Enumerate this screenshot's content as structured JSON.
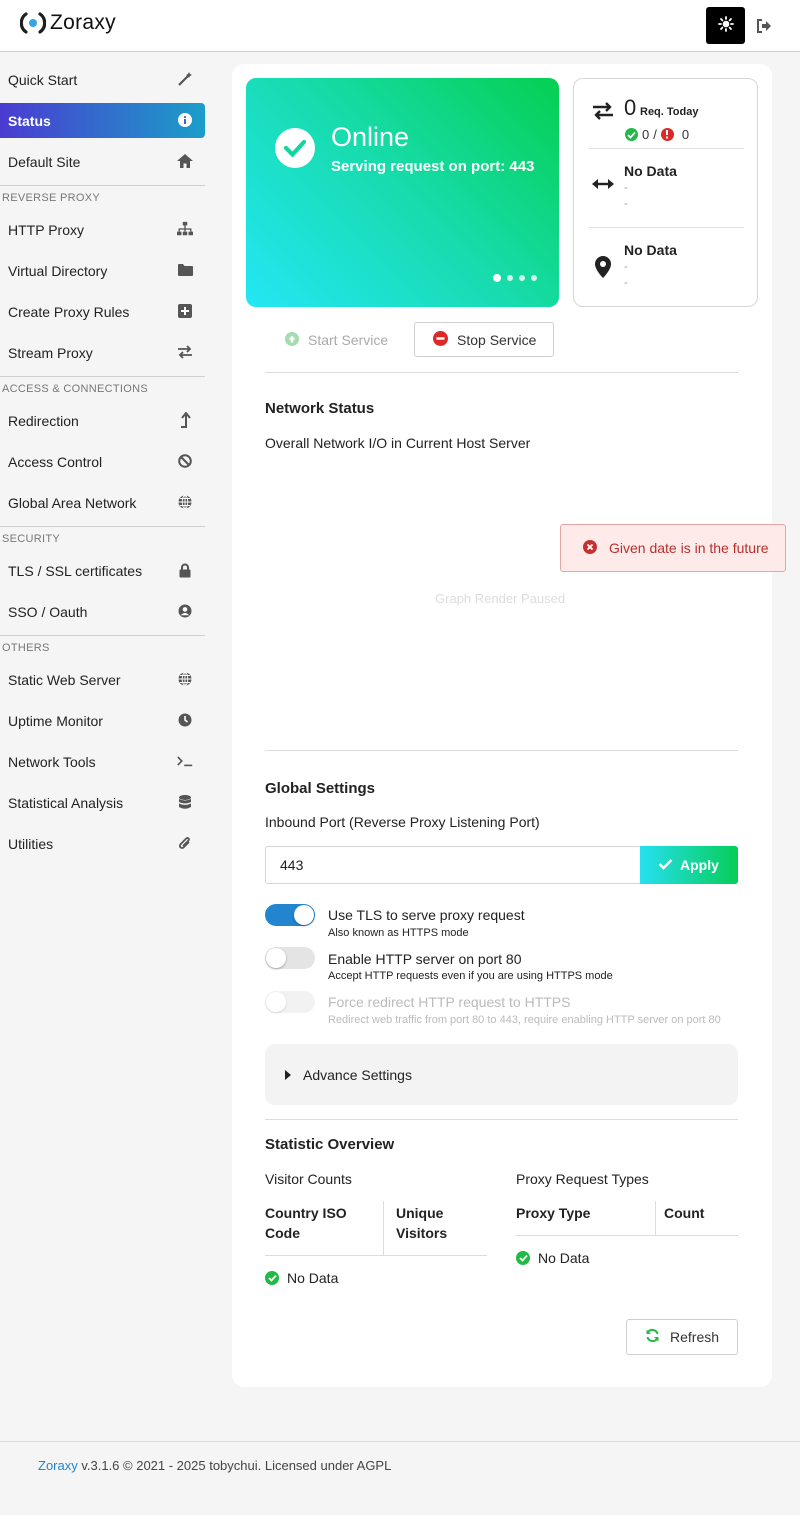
{
  "app": {
    "name": "Zoraxy"
  },
  "sidebar": {
    "items": [
      {
        "label": "Quick Start",
        "icon": "magic-wand-icon"
      },
      {
        "label": "Status",
        "icon": "info-circle-icon",
        "active": true
      },
      {
        "label": "Default Site",
        "icon": "home-icon"
      }
    ],
    "sections": [
      {
        "title": "REVERSE PROXY",
        "items": [
          {
            "label": "HTTP Proxy",
            "icon": "sitemap-icon"
          },
          {
            "label": "Virtual Directory",
            "icon": "folder-icon"
          },
          {
            "label": "Create Proxy Rules",
            "icon": "plus-square-icon"
          },
          {
            "label": "Stream Proxy",
            "icon": "exchange-icon"
          }
        ]
      },
      {
        "title": "ACCESS & CONNECTIONS",
        "items": [
          {
            "label": "Redirection",
            "icon": "level-up-icon"
          },
          {
            "label": "Access Control",
            "icon": "ban-icon"
          },
          {
            "label": "Global Area Network",
            "icon": "globe-icon"
          }
        ]
      },
      {
        "title": "SECURITY",
        "items": [
          {
            "label": "TLS / SSL certificates",
            "icon": "lock-icon"
          },
          {
            "label": "SSO / Oauth",
            "icon": "user-circle-icon"
          }
        ]
      },
      {
        "title": "OTHERS",
        "items": [
          {
            "label": "Static Web Server",
            "icon": "globe-icon"
          },
          {
            "label": "Uptime Monitor",
            "icon": "clock-icon"
          },
          {
            "label": "Network Tools",
            "icon": "terminal-icon"
          },
          {
            "label": "Statistical Analysis",
            "icon": "database-icon"
          },
          {
            "label": "Utilities",
            "icon": "paperclip-icon"
          }
        ]
      }
    ]
  },
  "status_card": {
    "title": "Online",
    "subtitle": "Serving request on port: 443",
    "carousel_pages": 4,
    "carousel_active": 1
  },
  "stats": {
    "requests_today": "0",
    "requests_label": "Req. Today",
    "success_count": "0",
    "separator": "/",
    "error_count": "0",
    "bandwidth_title": "No Data",
    "bandwidth_line1": "-",
    "bandwidth_line2": "-",
    "location_title": "No Data",
    "location_line1": "-",
    "location_line2": "-"
  },
  "service": {
    "start_label": "Start Service",
    "stop_label": "Stop Service"
  },
  "network": {
    "heading": "Network Status",
    "description": "Overall Network I/O in Current Host Server",
    "paused_text": "Graph Render Paused"
  },
  "toast": {
    "message": "Given date is in the future"
  },
  "global_settings": {
    "heading": "Global Settings",
    "port_label": "Inbound Port (Reverse Proxy Listening Port)",
    "port_value": "443",
    "apply_label": "Apply",
    "toggles": [
      {
        "label": "Use TLS to serve proxy request",
        "sub": "Also known as HTTPS mode",
        "state": "on"
      },
      {
        "label": "Enable HTTP server on port 80",
        "sub": "Accept HTTP requests even if you are using HTTPS mode",
        "state": "off"
      },
      {
        "label": "Force redirect HTTP request to HTTPS",
        "sub": "Redirect web traffic from port 80 to 443, require enabling HTTP server on port 80",
        "state": "disabled"
      }
    ],
    "advanced_label": "Advance Settings"
  },
  "statistics": {
    "heading": "Statistic Overview",
    "visitor_title": "Visitor Counts",
    "visitor_col1_line1": "Country ISO",
    "visitor_col1_line2": "Code",
    "visitor_col2_line1": "Unique",
    "visitor_col2_line2": "Visitors",
    "visitor_empty": "No Data",
    "proxy_title": "Proxy Request Types",
    "proxy_col1": "Proxy Type",
    "proxy_col2": "Count",
    "proxy_empty": "No Data",
    "refresh_label": "Refresh"
  },
  "footer": {
    "link": "Zoraxy",
    "text": " v.3.1.6 © 2021 - 2025 tobychui. Licensed under AGPL"
  },
  "colors": {
    "accent_blue": "#2185d0",
    "online_green": "#05cf51",
    "online_cyan": "#24e6f5",
    "error_red": "#db2828",
    "ok_green": "#21ba45"
  }
}
